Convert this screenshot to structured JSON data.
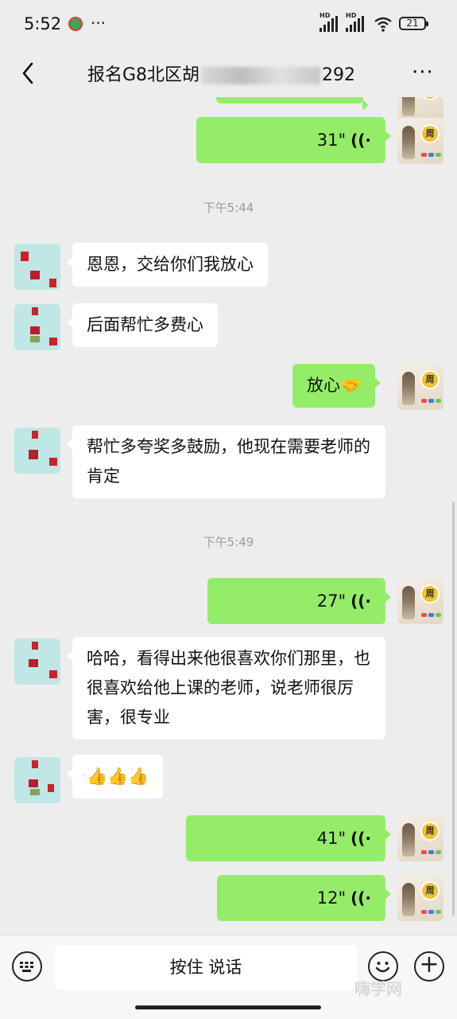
{
  "status": {
    "time": "5:52",
    "more": "···",
    "hd": "HD",
    "battery": "21"
  },
  "header": {
    "title_prefix": "报名G8北区胡",
    "title_suffix": "292",
    "more": "···"
  },
  "messages": [
    {
      "type": "timestamp",
      "text": "下午5:44"
    },
    {
      "type": "text",
      "side": "in",
      "text": "恩恩，交给你们我放心"
    },
    {
      "type": "text",
      "side": "in",
      "text": "后面帮忙多费心"
    },
    {
      "type": "text",
      "side": "out",
      "text": "放心🤝"
    },
    {
      "type": "text",
      "side": "in",
      "text": "帮忙多夸奖多鼓励，他现在需要老师的肯定"
    },
    {
      "type": "timestamp",
      "text": "下午5:49"
    },
    {
      "type": "voice",
      "side": "out",
      "duration": "27\""
    },
    {
      "type": "text",
      "side": "in",
      "text": "哈哈，看得出来他很喜欢你们那里，也很喜欢给他上课的老师，说老师很厉害，很专业"
    },
    {
      "type": "text",
      "side": "in",
      "text": "👍👍👍"
    },
    {
      "type": "voice",
      "side": "out",
      "duration": "41\""
    },
    {
      "type": "voice",
      "side": "out",
      "duration": "12\""
    }
  ],
  "top_voice": {
    "duration": "31\""
  },
  "avatar_badge": "周",
  "input": {
    "press_to_talk": "按住 说话"
  },
  "watermark": "嗨学网",
  "icons": [
    "back-arrow-icon",
    "more-icon",
    "voice-wave-icon",
    "keyboard-icon",
    "emoji-icon",
    "plus-icon",
    "signal-icon",
    "wifi-icon",
    "battery-icon"
  ]
}
